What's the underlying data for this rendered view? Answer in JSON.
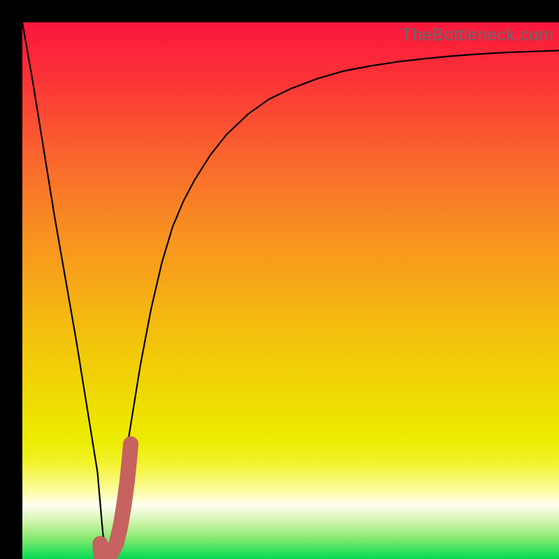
{
  "watermark": "TheBottleneck.com",
  "colors": {
    "frame": "#000000",
    "curve": "#000000",
    "marker": "#c6625f",
    "gradient_stops": [
      {
        "offset": 0.0,
        "color": "#fb173c"
      },
      {
        "offset": 0.1,
        "color": "#fb3138"
      },
      {
        "offset": 0.2,
        "color": "#fa5431"
      },
      {
        "offset": 0.3,
        "color": "#f97529"
      },
      {
        "offset": 0.4,
        "color": "#f89220"
      },
      {
        "offset": 0.5,
        "color": "#f6ac16"
      },
      {
        "offset": 0.6,
        "color": "#f3c50b"
      },
      {
        "offset": 0.7,
        "color": "#efdb03"
      },
      {
        "offset": 0.78,
        "color": "#ecec00"
      },
      {
        "offset": 0.82,
        "color": "#f2f22b"
      },
      {
        "offset": 0.87,
        "color": "#fcfc9a"
      },
      {
        "offset": 0.9,
        "color": "#fefef1"
      },
      {
        "offset": 0.93,
        "color": "#d2f4ad"
      },
      {
        "offset": 0.96,
        "color": "#8bea72"
      },
      {
        "offset": 1.0,
        "color": "#02db51"
      }
    ]
  },
  "chart_data": {
    "type": "line",
    "title": "",
    "xlabel": "",
    "ylabel": "",
    "xlim": [
      0,
      100
    ],
    "ylim": [
      -5,
      100
    ],
    "series": [
      {
        "name": "bottleneck-curve",
        "x": [
          0,
          2,
          4,
          6,
          8,
          10,
          12,
          14,
          15,
          16,
          18,
          20,
          22,
          24,
          26,
          28,
          30,
          32,
          35,
          38,
          42,
          46,
          50,
          55,
          60,
          65,
          70,
          75,
          80,
          85,
          90,
          95,
          100
        ],
        "y": [
          100,
          88,
          75,
          62,
          50,
          38,
          25,
          12,
          0,
          -5,
          6,
          20,
          33,
          44,
          53,
          60,
          65,
          69,
          74,
          78,
          82,
          85,
          87,
          89,
          90.5,
          91.5,
          92.3,
          92.9,
          93.4,
          93.8,
          94.1,
          94.3,
          94.5
        ]
      }
    ],
    "marker": {
      "name": "J-hook",
      "x": [
        14.5,
        14.6,
        14.8,
        15.5,
        16.5,
        17.5,
        18.3,
        19.0,
        19.5,
        19.9,
        20.2
      ],
      "y": [
        -2.0,
        -3.8,
        -4.8,
        -5.0,
        -4.0,
        -2.0,
        1.5,
        6.0,
        10.0,
        14.0,
        17.5
      ]
    }
  }
}
